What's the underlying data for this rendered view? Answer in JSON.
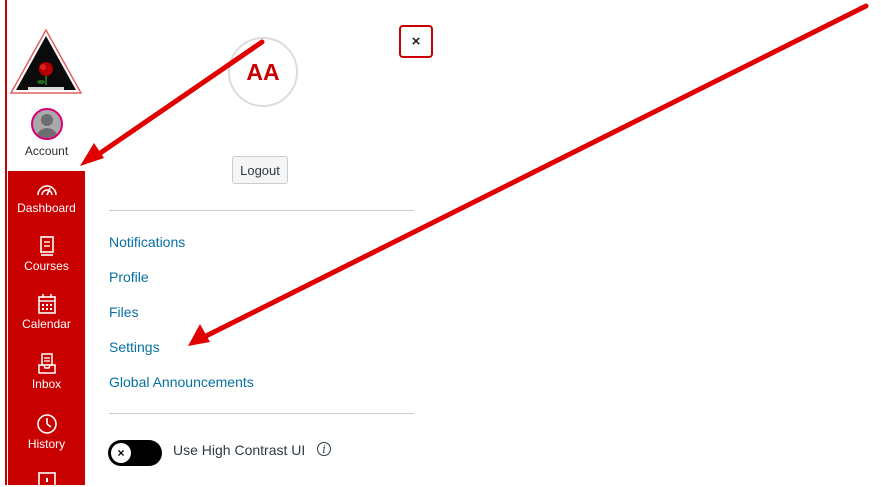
{
  "global_nav": {
    "account_label": "Account",
    "items": [
      {
        "label": "Dashboard",
        "icon": "dashboard-icon"
      },
      {
        "label": "Courses",
        "icon": "courses-icon"
      },
      {
        "label": "Calendar",
        "icon": "calendar-icon"
      },
      {
        "label": "Inbox",
        "icon": "inbox-icon"
      },
      {
        "label": "History",
        "icon": "history-icon"
      }
    ],
    "accent_color": "#c80000"
  },
  "tray": {
    "close_label": "×",
    "avatar_initials": "AA",
    "logout_label": "Logout",
    "links": [
      {
        "label": "Notifications"
      },
      {
        "label": "Profile"
      },
      {
        "label": "Files"
      },
      {
        "label": "Settings"
      },
      {
        "label": "Global Announcements"
      }
    ],
    "high_contrast": {
      "label": "Use High Contrast UI",
      "toggle_symbol": "×",
      "enabled": false
    },
    "link_color": "#0770a3"
  }
}
